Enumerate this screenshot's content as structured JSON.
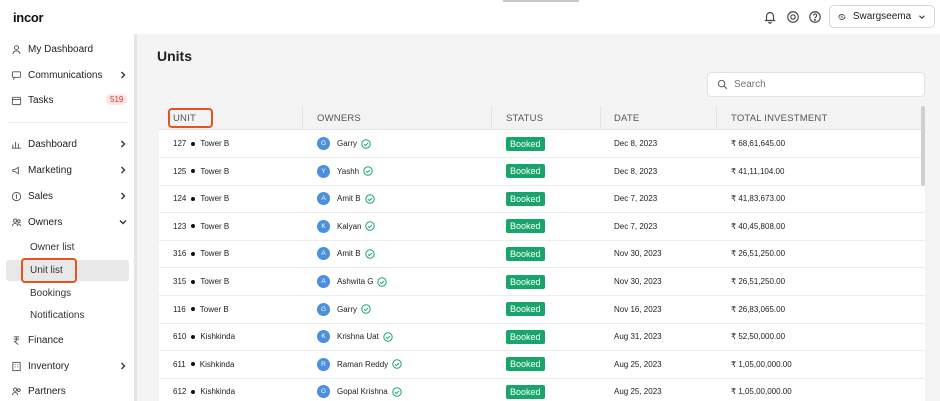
{
  "app": {
    "logo_text": "incor"
  },
  "header": {
    "user_name": "Swargseema"
  },
  "sidebar": {
    "items": [
      {
        "label": "My Dashboard"
      },
      {
        "label": "Communications"
      },
      {
        "label": "Tasks",
        "badge": "519"
      },
      {
        "label": "Dashboard"
      },
      {
        "label": "Marketing"
      },
      {
        "label": "Sales"
      },
      {
        "label": "Owners"
      },
      {
        "label": "Finance"
      },
      {
        "label": "Inventory"
      },
      {
        "label": "Partners"
      }
    ],
    "owners_sub": [
      {
        "label": "Owner list"
      },
      {
        "label": "Unit list"
      },
      {
        "label": "Bookings"
      },
      {
        "label": "Notifications"
      }
    ]
  },
  "main": {
    "title": "Units",
    "search_placeholder": "Search",
    "columns": [
      "UNIT",
      "OWNERS",
      "STATUS",
      "DATE",
      "TOTAL INVESTMENT"
    ],
    "rows": [
      {
        "unit": "127",
        "tower": "Tower B",
        "initial": "G",
        "owner": "Garry",
        "status": "Booked",
        "date": "Dec 8, 2023",
        "investment": "₹ 68,61,645.00"
      },
      {
        "unit": "125",
        "tower": "Tower B",
        "initial": "Y",
        "owner": "Yashh",
        "status": "Booked",
        "date": "Dec 8, 2023",
        "investment": "₹ 41,11,104.00"
      },
      {
        "unit": "124",
        "tower": "Tower B",
        "initial": "A",
        "owner": "Amit B",
        "status": "Booked",
        "date": "Dec 7, 2023",
        "investment": "₹ 41,83,673.00"
      },
      {
        "unit": "123",
        "tower": "Tower B",
        "initial": "K",
        "owner": "Kalyan",
        "status": "Booked",
        "date": "Dec 7, 2023",
        "investment": "₹ 40,45,808.00"
      },
      {
        "unit": "316",
        "tower": "Tower B",
        "initial": "A",
        "owner": "Amit B",
        "status": "Booked",
        "date": "Nov 30, 2023",
        "investment": "₹ 26,51,250.00"
      },
      {
        "unit": "315",
        "tower": "Tower B",
        "initial": "A",
        "owner": "Ashwita G",
        "status": "Booked",
        "date": "Nov 30, 2023",
        "investment": "₹ 26,51,250.00"
      },
      {
        "unit": "116",
        "tower": "Tower B",
        "initial": "G",
        "owner": "Garry",
        "status": "Booked",
        "date": "Nov 16, 2023",
        "investment": "₹ 26,83,065.00"
      },
      {
        "unit": "610",
        "tower": "Kishkinda",
        "initial": "K",
        "owner": "Krishna Uat",
        "status": "Booked",
        "date": "Aug 31, 2023",
        "investment": "₹ 52,50,000.00"
      },
      {
        "unit": "611",
        "tower": "Kishkinda",
        "initial": "R",
        "owner": "Raman Reddy",
        "status": "Booked",
        "date": "Aug 25, 2023",
        "investment": "₹ 1,05,00,000.00"
      },
      {
        "unit": "612",
        "tower": "Kishkinda",
        "initial": "G",
        "owner": "Gopal Krishna",
        "status": "Booked",
        "date": "Aug 25, 2023",
        "investment": "₹ 1,05,00,000.00"
      }
    ]
  },
  "colors": {
    "accent_highlight": "#e35420",
    "status_booked": "#18a56b",
    "avatar": "#4a8fe0"
  }
}
